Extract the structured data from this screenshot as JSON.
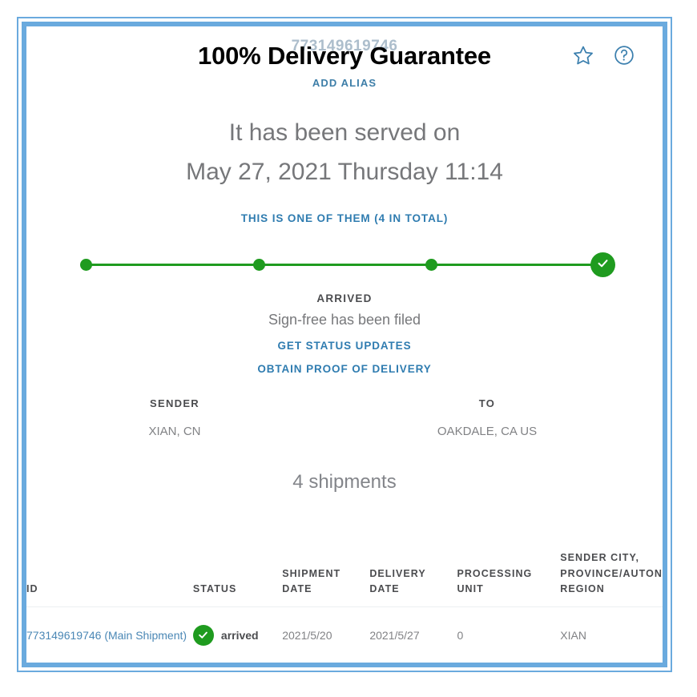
{
  "header": {
    "tracking_number": "773149619746",
    "title": "100% Delivery Guarantee",
    "add_alias_label": "ADD ALIAS",
    "star_icon": "star-icon",
    "help_icon": "help-circle-icon"
  },
  "served": {
    "line1": "It has been served on",
    "line2": "May 27, 2021 Thursday 11:14",
    "one_of_them_label": "THIS IS ONE OF THEM (4 IN TOTAL)"
  },
  "progress": {
    "accent_color": "#1f9b1f",
    "nodes": [
      {
        "name": "node-1",
        "position_pct": 0,
        "completed": true
      },
      {
        "name": "node-2",
        "position_pct": 33,
        "completed": true
      },
      {
        "name": "node-3",
        "position_pct": 66,
        "completed": true
      },
      {
        "name": "node-final",
        "position_pct": 100,
        "completed": true,
        "icon": "check-icon"
      }
    ]
  },
  "status": {
    "label": "ARRIVED",
    "detail": "Sign-free has been filed",
    "links": [
      "GET STATUS UPDATES",
      "OBTAIN PROOF OF DELIVERY"
    ]
  },
  "endpoints": {
    "sender": {
      "label": "SENDER",
      "value": "XIAN, CN"
    },
    "to": {
      "label": "TO",
      "value": "OAKDALE, CA US"
    }
  },
  "shipments": {
    "count_label": "4 shipments",
    "columns": [
      "ID",
      "STATUS",
      "SHIPMENT DATE",
      "DELIVERY DATE",
      "PROCESSING UNIT",
      "SENDER CITY, PROVINCE/AUTONOMOUS REGION"
    ],
    "rows": [
      {
        "id": "773149619746 (Main Shipment)",
        "status": "arrived",
        "status_icon": "check-circle-icon",
        "shipment_date": "2021/5/20",
        "delivery_date": "2021/5/27",
        "processing_unit": "0",
        "sender_city": "XIAN"
      }
    ]
  },
  "colors": {
    "frame_blue": "#6aaade",
    "link_blue": "#2f7cb0",
    "success_green": "#1f9b1f",
    "muted_gray": "#818285"
  }
}
